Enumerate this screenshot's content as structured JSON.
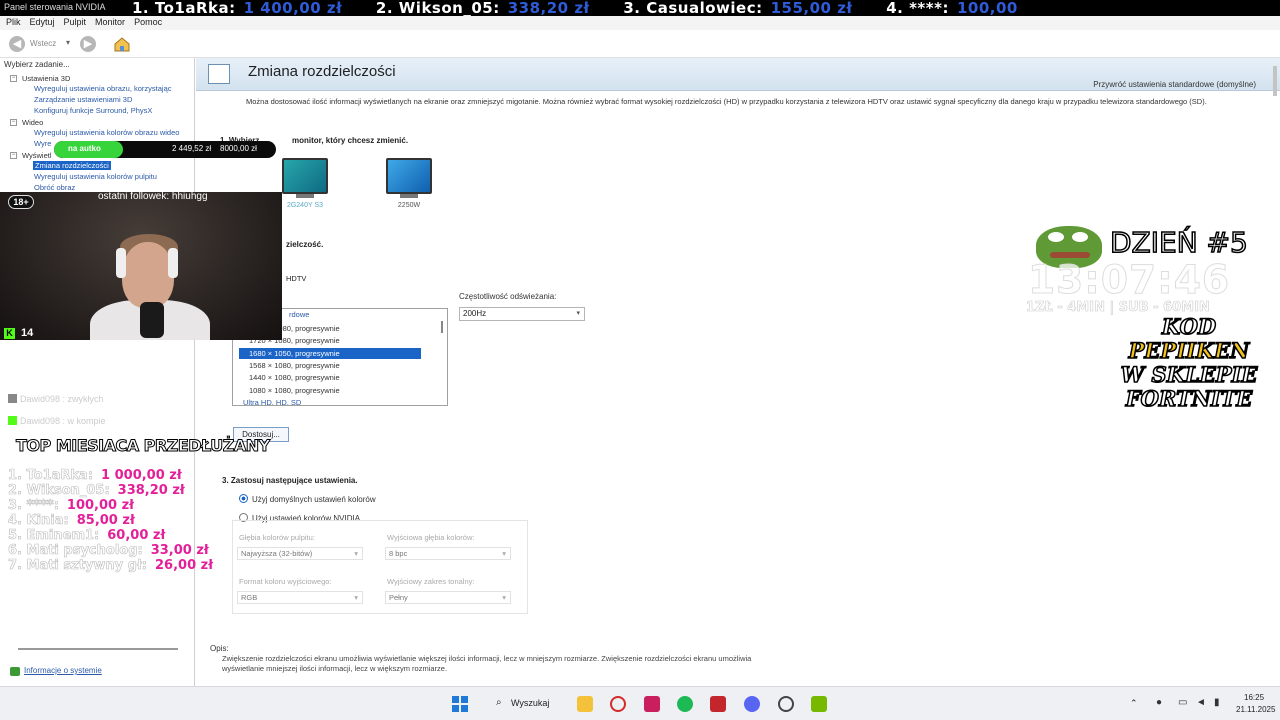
{
  "ticker": {
    "window_title": "Panel sterowania NVIDIA",
    "items": [
      {
        "name": "1. To1aRka:",
        "amount": "1 400,00 zł"
      },
      {
        "name": "2. Wikson_05:",
        "amount": "338,20 zł"
      },
      {
        "name": "3. Casualowiec:",
        "amount": "155,00 zł"
      },
      {
        "name": "4. ****:",
        "amount": "100,00"
      }
    ]
  },
  "menubar": [
    "Plik",
    "Edytuj",
    "Pulpit",
    "Monitor",
    "Pomoc"
  ],
  "toolbar": {
    "back_label": "Wstecz",
    "dropdown": "▾"
  },
  "sidebar": {
    "header": "Wybierz zadanie...",
    "cat_3d": "Ustawienia 3D",
    "items_3d": [
      "Wyreguluj ustawienia obrazu, korzystając",
      "Zarządzanie ustawieniami 3D",
      "Konfiguruj funkcje Surround, PhysX"
    ],
    "cat_video": "Wideo",
    "items_video": [
      "Wyreguluj ustawienia kolorów obrazu wideo",
      "Wyre"
    ],
    "cat_display": "Wyświetl",
    "items_display": [
      "Zmiana rozdzielczości",
      "Wyreguluj ustawienia kolorów pulpitu",
      "Obróć obraz"
    ],
    "info_link": "Informacje o systemie"
  },
  "main": {
    "title": "Zmiana rozdzielczości",
    "restore": "Przywróć ustawienia standardowe (domyślne)",
    "intro": "Można dostosować ilość informacji wyświetlanych na ekranie oraz zmniejszyć migotanie. Można również wybrać format wysokiej rozdzielczości (HD) w przypadku korzystania z telewizora HDTV oraz ustawić sygnał specyficzny dla danego kraju w przypadku telewizora standardowego (SD).",
    "step1": "monitor, który chcesz zmienić.",
    "step1_prefix": "1. Wybierz",
    "monitors": [
      "2G240Y S3",
      "2250W"
    ],
    "step2": "zielczość.",
    "hdtv": "HDTV",
    "res_group": "rdowe",
    "res_group_footer": "Ultra HD, HD, SD",
    "resolutions": [
      "1920 × 1080, progresywnie",
      "1720 × 1080, progresywnie",
      "1680 × 1050, progresywnie",
      "1568 × 1080, progresywnie",
      "1440 × 1080, progresywnie",
      "1080 × 1080, progresywnie"
    ],
    "selected_resolution_index": 2,
    "freq_label": "Częstotliwość odświeżania:",
    "freq_value": "200Hz",
    "customize": "Dostosuj...",
    "step3": "3. Zastosuj następujące ustawienia.",
    "radio_default": "Użyj domyślnych ustawień kolorów",
    "radio_nvidia": "Użyj ustawień kolorów NVIDIA",
    "depth_label": "Głębia kolorów pulpitu:",
    "depth_value": "Najwyższa (32-bitów)",
    "out_depth_label": "Wyjściowa głębia kolorów:",
    "out_depth_value": "8 bpc",
    "format_label": "Format koloru wyjściowego:",
    "format_value": "RGB",
    "range_label": "Wyjściowy zakres tonalny:",
    "range_value": "Pełny",
    "desc_header": "Opis:",
    "desc": "Zwiększenie rozdzielczości ekranu umożliwia wyświetlanie większej ilości informacji, lecz w mniejszym rozmiarze. Zwiększenie rozdzielczości ekranu umożliwia wyświetlanie mniejszej ilości informacji, lecz w większym rozmiarze."
  },
  "overlay": {
    "goal_label": "na autko",
    "goal_current": "2 449,52 zł",
    "goal_target": "8000,00 zł",
    "goal_progress": 0.31,
    "age_badge": "18+",
    "follower": "ostatni followek: hhiuhgg",
    "viewers": "14",
    "chat": [
      "Dawid098 : zwykłych",
      "Dawid098 : w kompie"
    ],
    "top_header": "TOP MIESIACA PRZEDŁUŻANY",
    "top": [
      {
        "name": "1. To1aRka:",
        "amount": "1 000,00 zł"
      },
      {
        "name": "2. Wikson_05:",
        "amount": "338,20 zł"
      },
      {
        "name": "3. ****:",
        "amount": "100,00 zł"
      },
      {
        "name": "4. Kinia:",
        "amount": "85,00 zł"
      },
      {
        "name": "5. Eminem1:",
        "amount": "60,00 zł"
      },
      {
        "name": "6. Mati psycholog:",
        "amount": "33,00 zł"
      },
      {
        "name": "7. Mati sztywny gł:",
        "amount": "26,00 zł"
      }
    ],
    "day": "DZIEŃ #5",
    "timer": "13:07:46",
    "rate": "1ZŁ - 4MIN | SUB - 60MIN",
    "promo": [
      "KOD",
      "PEPIIKEN",
      "W SKLEPIE",
      "FORTNITE"
    ]
  },
  "taskbar": {
    "search": "Wyszukaj",
    "time": "16:25",
    "date": "21.11.2025"
  },
  "colors": {
    "accent": "#1a63c7",
    "donation_amount": "#e41f9a",
    "ticker_amount": "#2f5bd9",
    "goal_fill": "#38d43c"
  }
}
